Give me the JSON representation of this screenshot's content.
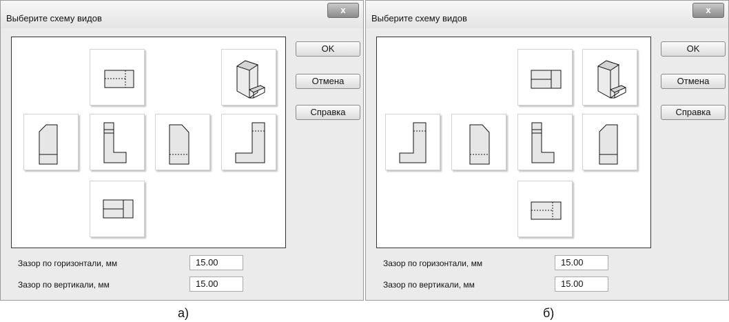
{
  "dialogs": [
    {
      "title": "Выберите схему видов",
      "close_label": "x",
      "buttons": {
        "ok": "OK",
        "cancel": "Отмена",
        "help": "Справка"
      },
      "fields": [
        {
          "label": "Зазор по горизонтали, мм",
          "value": "15.00"
        },
        {
          "label": "Зазор по вертикали, мм",
          "value": "15.00"
        }
      ],
      "views": [
        "top-view",
        "isometric-view",
        "right-side-view",
        "front-view",
        "rear-view",
        "left-side-view",
        "bottom-view"
      ],
      "caption": "а)"
    },
    {
      "title": "Выберите схему видов",
      "close_label": "x",
      "buttons": {
        "ok": "OK",
        "cancel": "Отмена",
        "help": "Справка"
      },
      "fields": [
        {
          "label": "Зазор по горизонтали, мм",
          "value": "15.00"
        },
        {
          "label": "Зазор по вертикали, мм",
          "value": "15.00"
        }
      ],
      "views": [
        "bottom-view",
        "isometric-view",
        "left-side-view",
        "rear-view",
        "front-view",
        "right-side-view",
        "top-view"
      ],
      "caption": "б)"
    }
  ]
}
